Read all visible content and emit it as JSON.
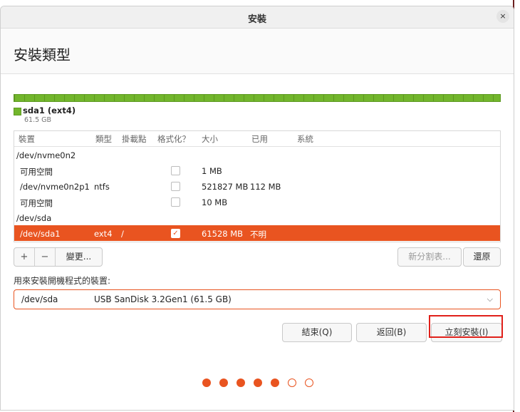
{
  "window": {
    "title": "安裝",
    "close_glyph": "×"
  },
  "page_title": "安裝類型",
  "disk_usage": {
    "partition_name": "sda1 (ext4)",
    "partition_size": "61.5 GB",
    "fill_fraction": 1.0,
    "color": "#72b62c"
  },
  "table": {
    "headers": [
      "裝置",
      "類型",
      "掛載點",
      "格式化？",
      "大小",
      "已用",
      "系統"
    ],
    "rows": [
      {
        "device": "/dev/nvme0n2",
        "type": "",
        "mount": "",
        "format": null,
        "size": "",
        "used": "",
        "system": "",
        "selected": false
      },
      {
        "device": "可用空間",
        "type": "",
        "mount": "",
        "format": false,
        "size": "1 MB",
        "used": "",
        "system": "",
        "selected": false
      },
      {
        "device": "/dev/nvme0n2p1",
        "type": "ntfs",
        "mount": "",
        "format": false,
        "size": "521827 MB",
        "used": "112 MB",
        "system": "",
        "selected": false
      },
      {
        "device": "可用空間",
        "type": "",
        "mount": "",
        "format": false,
        "size": "10 MB",
        "used": "",
        "system": "",
        "selected": false
      },
      {
        "device": "/dev/sda",
        "type": "",
        "mount": "",
        "format": null,
        "size": "",
        "used": "",
        "system": "",
        "selected": false
      },
      {
        "device": "/dev/sda1",
        "type": "ext4",
        "mount": "/",
        "format": true,
        "size": "61528 MB",
        "used": "不明",
        "system": "",
        "selected": true
      }
    ]
  },
  "toolbar": {
    "add_glyph": "+",
    "remove_glyph": "−",
    "change_label": "變更...",
    "new_table_label": "新分割表...",
    "revert_label": "還原"
  },
  "bootloader": {
    "label": "用來安裝開機程式的裝置:",
    "device": "/dev/sda",
    "description": "USB  SanDisk 3.2Gen1 (61.5 GB)"
  },
  "actions": {
    "quit_label": "結束(Q)",
    "back_label": "返回(B)",
    "install_label": "立刻安裝(I)"
  },
  "progress": {
    "total_steps": 7,
    "completed_steps": 5
  },
  "colors": {
    "accent": "#e95420",
    "highlight_box": "#e0201a"
  }
}
